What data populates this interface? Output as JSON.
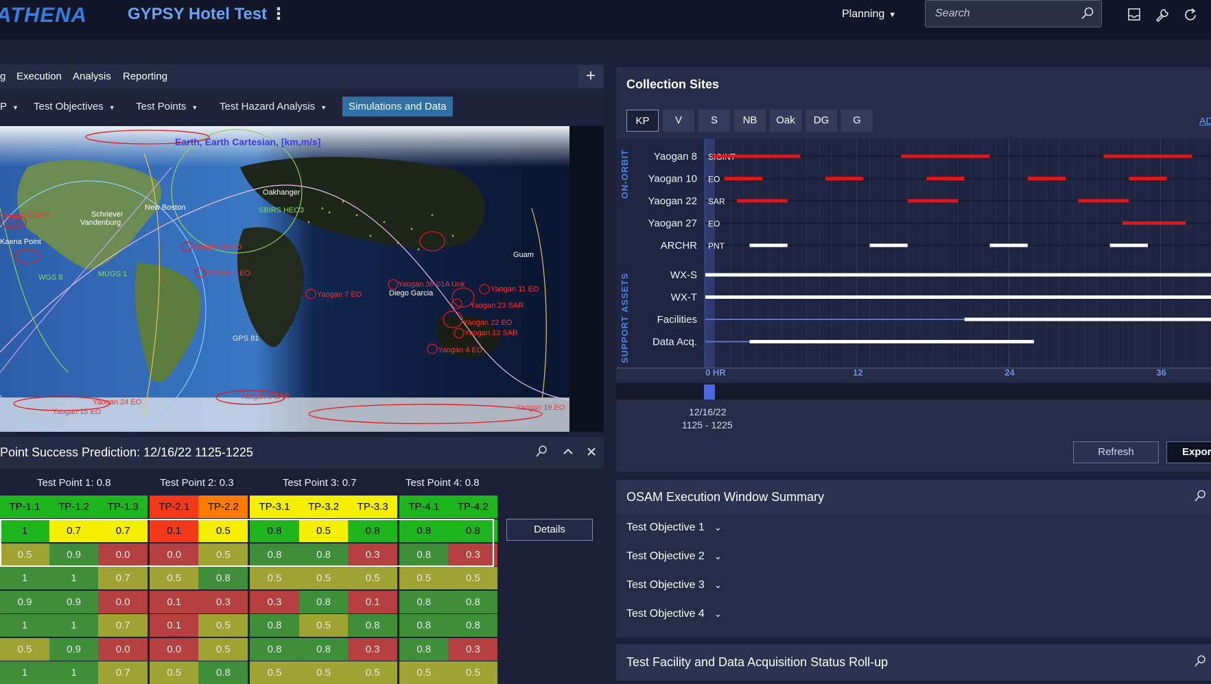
{
  "header": {
    "brand": "ATHENA",
    "app_title": "GYPSY Hotel Test",
    "planning_label": "Planning",
    "search_placeholder": "Search"
  },
  "left_tabs": [
    {
      "label": "g"
    },
    {
      "label": "Execution"
    },
    {
      "label": "Analysis"
    },
    {
      "label": "Reporting"
    }
  ],
  "subnav": {
    "items": [
      "Test Objectives",
      "Test Points",
      "Test Hazard Analysis"
    ],
    "active": "Simulations and Data"
  },
  "map": {
    "title": "Earth, Earth Cartesian, [km,m/s]",
    "labels": [
      "Oakhanger",
      "SBIRS HEO3",
      "New Boston",
      "Schriever",
      "Vandenburg",
      "Kaena Point",
      "WGS 8",
      "MUGS 1",
      "Yaogan 3 SAR",
      "Yaogan 28 EO",
      "Yaogan 2 EO",
      "Yaogan 7 EO",
      "Diego Garcia",
      "Yaogan 36-01A Unk",
      "Guam",
      "Yaogan 11 EO",
      "Yaogan 23 SAR",
      "Yaogan 22 EO",
      "Yaogan 13 SAR",
      "Yaogan 4 EO",
      "GPS 81",
      "Yaogan 24 EO",
      "Yaogan 15 EO",
      "Yaogan 8 SAR",
      "Yaogan 19 EO"
    ]
  },
  "prediction": {
    "title": "Point Success Prediction: 12/16/22  1125-1225",
    "groups": [
      {
        "label": "Test Point 1: 0.8"
      },
      {
        "label": "Test Point 2: 0.3"
      },
      {
        "label": "Test Point 3: 0.7"
      },
      {
        "label": "Test Point 4: 0.8"
      }
    ],
    "columns": [
      "TP-1.1",
      "TP-1.2",
      "TP-1.3",
      "TP-2.1",
      "TP-2.2",
      "TP-3.1",
      "TP-3.2",
      "TP-3.3",
      "TP-4.1",
      "TP-4.2"
    ],
    "rows": [
      [
        "1",
        "0.7",
        "0.7",
        "0.1",
        "0.5",
        "0.8",
        "0.5",
        "0.8",
        "0.8",
        "0.8"
      ],
      [
        "0.5",
        "0.9",
        "0.0",
        "0.0",
        "0.5",
        "0.8",
        "0.8",
        "0.3",
        "0.8",
        "0.3"
      ],
      [
        "1",
        "1",
        "0.7",
        "0.5",
        "0.8",
        "0.5",
        "0.5",
        "0.5",
        "0.5",
        "0.5"
      ],
      [
        "0.9",
        "0.9",
        "0.0",
        "0.1",
        "0.3",
        "0.3",
        "0.8",
        "0.1",
        "0.8",
        "0.8"
      ],
      [
        "1",
        "1",
        "0.7",
        "0.1",
        "0.5",
        "0.8",
        "0.5",
        "0.8",
        "0.8",
        "0.8"
      ],
      [
        "0.5",
        "0.9",
        "0.0",
        "0.0",
        "0.5",
        "0.8",
        "0.8",
        "0.3",
        "0.8",
        "0.3"
      ],
      [
        "1",
        "1",
        "0.7",
        "0.5",
        "0.8",
        "0.5",
        "0.5",
        "0.5",
        "0.5",
        "0.5"
      ]
    ],
    "details_label": "Details"
  },
  "collection_sites": {
    "title": "Collection Sites",
    "tabs": [
      "KP",
      "V",
      "S",
      "NB",
      "Oak",
      "DG",
      "G"
    ],
    "active_tab": "KP",
    "ad_link": "AD",
    "section_on_orbit": "ON-ORBIT",
    "section_support": "SUPPORT ASSETS",
    "on_orbit": [
      {
        "name": "Yaogan 8",
        "tag": "SIGINT",
        "color": "#e41515",
        "segments": [
          [
            0.5,
            7.5
          ],
          [
            15.5,
            22.5
          ],
          [
            31.5,
            38.5
          ]
        ]
      },
      {
        "name": "Yaogan 10",
        "tag": "EO",
        "color": "#e41515",
        "segments": [
          [
            1.5,
            4.5
          ],
          [
            9.5,
            12.5
          ],
          [
            17.5,
            20.5
          ],
          [
            25.5,
            28.5
          ],
          [
            33.5,
            36.5
          ]
        ]
      },
      {
        "name": "Yaogan 22",
        "tag": "SAR",
        "color": "#e41515",
        "segments": [
          [
            2.5,
            6.5
          ],
          [
            16,
            20
          ],
          [
            29.5,
            33.5
          ]
        ]
      },
      {
        "name": "Yaogan 27",
        "tag": "EO",
        "color": "#e41515",
        "segments": [
          [
            33,
            38
          ]
        ]
      },
      {
        "name": "ARCHR",
        "tag": "PNT",
        "color": "#ffffff",
        "segments": [
          [
            3.5,
            6.5
          ],
          [
            13,
            16
          ],
          [
            22.5,
            25.5
          ],
          [
            32,
            35
          ]
        ]
      }
    ],
    "support": [
      {
        "name": "WX-S",
        "segments": [
          [
            0,
            40
          ]
        ]
      },
      {
        "name": "WX-T",
        "segments": [
          [
            0,
            40
          ]
        ]
      },
      {
        "name": "Facilities",
        "segments": [
          [
            20.5,
            40
          ]
        ],
        "pending": [
          [
            0,
            20.5
          ]
        ]
      },
      {
        "name": "Data Acq.",
        "segments": [
          [
            3.5,
            26
          ]
        ],
        "pending": [
          [
            0,
            3.5
          ]
        ]
      }
    ],
    "axis_ticks": [
      "0 HR",
      "12",
      "24",
      "36"
    ],
    "x_range": [
      0,
      40
    ],
    "date": "12/16/22",
    "time_range": "1125 - 1225",
    "refresh_label": "Refresh",
    "export_label": "Expor"
  },
  "osam": {
    "title": "OSAM Execution Window Summary",
    "objectives": [
      "Test Objective 1",
      "Test Objective 2",
      "Test Objective 3",
      "Test Objective 4"
    ]
  },
  "facility": {
    "title": "Test Facility and Data Acquisition Status Roll-up"
  },
  "colors": {
    "accent": "#3a7de0",
    "green": "#1fb51f",
    "yellow": "#f4f000",
    "red": "#f23a1b",
    "orange": "#ff7a00"
  }
}
